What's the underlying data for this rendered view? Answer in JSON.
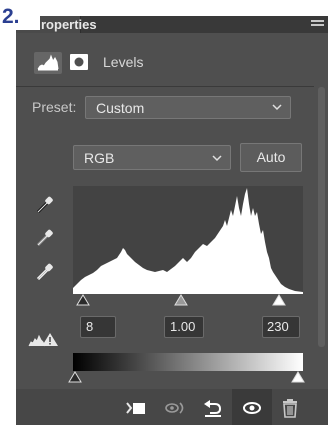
{
  "step_badge": "2.",
  "panel": {
    "title": "roperties",
    "adjustment_label": "Levels"
  },
  "preset": {
    "label": "Preset:",
    "value": "Custom"
  },
  "channel": {
    "value": "RGB"
  },
  "auto_label": "Auto",
  "input_levels": {
    "black": "8",
    "gamma": "1.00",
    "white": "230"
  },
  "icons": {
    "tab_histogram": "histogram-icon",
    "tab_mask": "mask-icon",
    "eyedroppers": [
      "black-eyedropper-icon",
      "gray-eyedropper-icon",
      "white-eyedropper-icon"
    ],
    "clipping_warning": "clipping-warning-icon",
    "bottom_bar": [
      "clip-to-layer-icon",
      "view-previous-state-icon",
      "reset-icon",
      "visibility-eye-icon",
      "trash-icon"
    ]
  },
  "colors": {
    "step_badge": "#2b3f91",
    "panel_bg": "#4f4f4f",
    "histogram_fill": "#ffffff"
  }
}
